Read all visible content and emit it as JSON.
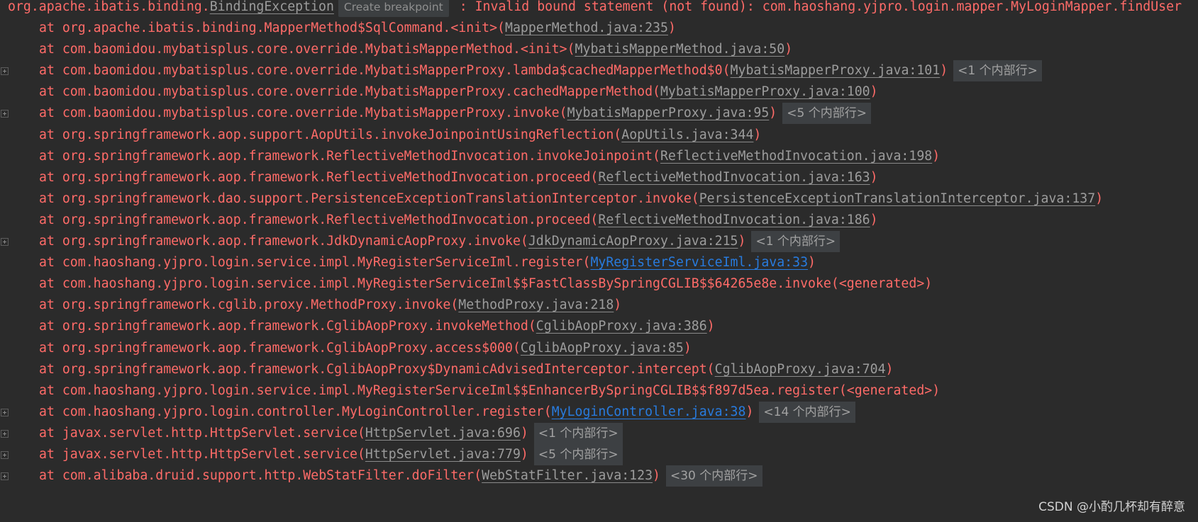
{
  "exception": {
    "prefix": "org.apache.ibatis.binding.",
    "class_link": "BindingException",
    "breakpoint_label": "Create breakpoint",
    "message": " : Invalid bound statement (not found): com.haoshang.yjpro.login.mapper.MyLoginMapper.findUser"
  },
  "frames": [
    {
      "text": "at org.apache.ibatis.binding.MapperMethod$SqlCommand.<init>(",
      "link": "MapperMethod.java:235",
      "suffix": ")",
      "folded": "",
      "project": false,
      "gutter": false
    },
    {
      "text": "at com.baomidou.mybatisplus.core.override.MybatisMapperMethod.<init>(",
      "link": "MybatisMapperMethod.java:50",
      "suffix": ")",
      "folded": "",
      "project": false,
      "gutter": false
    },
    {
      "text": "at com.baomidou.mybatisplus.core.override.MybatisMapperProxy.lambda$cachedMapperMethod$0(",
      "link": "MybatisMapperProxy.java:101",
      "suffix": ")",
      "folded": "<1 个内部行>",
      "project": false,
      "gutter": true
    },
    {
      "text": "at com.baomidou.mybatisplus.core.override.MybatisMapperProxy.cachedMapperMethod(",
      "link": "MybatisMapperProxy.java:100",
      "suffix": ")",
      "folded": "",
      "project": false,
      "gutter": false
    },
    {
      "text": "at com.baomidou.mybatisplus.core.override.MybatisMapperProxy.invoke(",
      "link": "MybatisMapperProxy.java:95",
      "suffix": ")",
      "folded": "<5 个内部行>",
      "project": false,
      "gutter": true
    },
    {
      "text": "at org.springframework.aop.support.AopUtils.invokeJoinpointUsingReflection(",
      "link": "AopUtils.java:344",
      "suffix": ")",
      "folded": "",
      "project": false,
      "gutter": false
    },
    {
      "text": "at org.springframework.aop.framework.ReflectiveMethodInvocation.invokeJoinpoint(",
      "link": "ReflectiveMethodInvocation.java:198",
      "suffix": ")",
      "folded": "",
      "project": false,
      "gutter": false
    },
    {
      "text": "at org.springframework.aop.framework.ReflectiveMethodInvocation.proceed(",
      "link": "ReflectiveMethodInvocation.java:163",
      "suffix": ")",
      "folded": "",
      "project": false,
      "gutter": false
    },
    {
      "text": "at org.springframework.dao.support.PersistenceExceptionTranslationInterceptor.invoke(",
      "link": "PersistenceExceptionTranslationInterceptor.java:137",
      "suffix": ")",
      "folded": "",
      "project": false,
      "gutter": false
    },
    {
      "text": "at org.springframework.aop.framework.ReflectiveMethodInvocation.proceed(",
      "link": "ReflectiveMethodInvocation.java:186",
      "suffix": ")",
      "folded": "",
      "project": false,
      "gutter": false
    },
    {
      "text": "at org.springframework.aop.framework.JdkDynamicAopProxy.invoke(",
      "link": "JdkDynamicAopProxy.java:215",
      "suffix": ")",
      "folded": "<1 个内部行>",
      "project": false,
      "gutter": true
    },
    {
      "text": "at com.haoshang.yjpro.login.service.impl.MyRegisterServiceIml.register(",
      "link": "MyRegisterServiceIml.java:33",
      "suffix": ")",
      "folded": "",
      "project": true,
      "gutter": false
    },
    {
      "text": "at com.haoshang.yjpro.login.service.impl.MyRegisterServiceIml$$FastClassBySpringCGLIB$$64265e8e.invoke(<generated>)",
      "link": "",
      "suffix": "",
      "folded": "",
      "project": false,
      "gutter": false
    },
    {
      "text": "at org.springframework.cglib.proxy.MethodProxy.invoke(",
      "link": "MethodProxy.java:218",
      "suffix": ")",
      "folded": "",
      "project": false,
      "gutter": false
    },
    {
      "text": "at org.springframework.aop.framework.CglibAopProxy.invokeMethod(",
      "link": "CglibAopProxy.java:386",
      "suffix": ")",
      "folded": "",
      "project": false,
      "gutter": false
    },
    {
      "text": "at org.springframework.aop.framework.CglibAopProxy.access$000(",
      "link": "CglibAopProxy.java:85",
      "suffix": ")",
      "folded": "",
      "project": false,
      "gutter": false
    },
    {
      "text": "at org.springframework.aop.framework.CglibAopProxy$DynamicAdvisedInterceptor.intercept(",
      "link": "CglibAopProxy.java:704",
      "suffix": ")",
      "folded": "",
      "project": false,
      "gutter": false
    },
    {
      "text": "at com.haoshang.yjpro.login.service.impl.MyRegisterServiceIml$$EnhancerBySpringCGLIB$$f897d5ea.register(<generated>)",
      "link": "",
      "suffix": "",
      "folded": "",
      "project": false,
      "gutter": false
    },
    {
      "text": "at com.haoshang.yjpro.login.controller.MyLoginController.register(",
      "link": "MyLoginController.java:38",
      "suffix": ")",
      "folded": "<14 个内部行>",
      "project": true,
      "gutter": true
    },
    {
      "text": "at javax.servlet.http.HttpServlet.service(",
      "link": "HttpServlet.java:696",
      "suffix": ")",
      "folded": "<1 个内部行>",
      "project": false,
      "gutter": true
    },
    {
      "text": "at javax.servlet.http.HttpServlet.service(",
      "link": "HttpServlet.java:779",
      "suffix": ")",
      "folded": "<5 个内部行>",
      "project": false,
      "gutter": true
    },
    {
      "text": "at com.alibaba.druid.support.http.WebStatFilter.doFilter(",
      "link": "WebStatFilter.java:123",
      "suffix": ")",
      "folded": "<30 个内部行>",
      "project": false,
      "gutter": true
    }
  ],
  "watermark": "CSDN @小酌几杯却有醉意"
}
